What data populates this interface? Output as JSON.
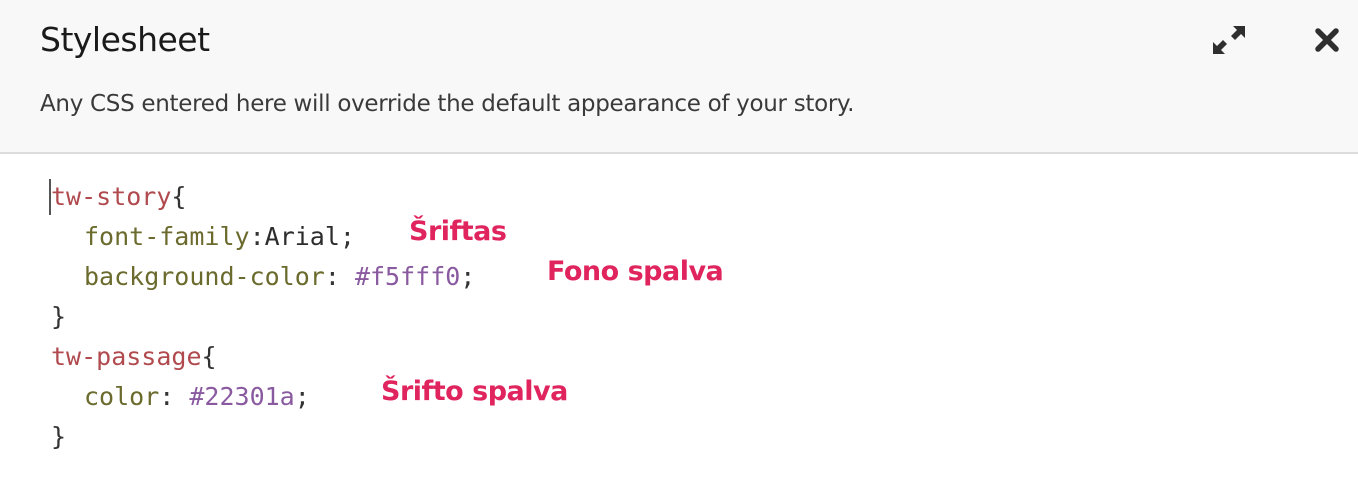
{
  "header": {
    "title": "Stylesheet",
    "subtitle": "Any CSS entered here will override the default appearance of your story."
  },
  "icons": {
    "expand": "expand-arrows-icon",
    "close": "close-x-icon"
  },
  "code": {
    "line1_selector": "tw-story",
    "line1_brace": "{",
    "line2_prop": "font-family",
    "line2_colon": ":",
    "line2_value": "Arial",
    "line2_semi": ";",
    "line3_prop": "background-color",
    "line3_colon": ": ",
    "line3_value": "#f5fff0",
    "line3_semi": ";",
    "line4_brace": "}",
    "line5_selector": "tw-passage",
    "line5_brace": "{",
    "line6_prop": "color",
    "line6_colon": ": ",
    "line6_value": "#22301a",
    "line6_semi": ";",
    "line7_brace": "}"
  },
  "annotations": {
    "font": "Šriftas",
    "background": "Fono spalva",
    "font_color": "Šrifto spalva"
  },
  "colors": {
    "selector": "#b04a4e",
    "property": "#6b6b2e",
    "number": "#8a5aa0",
    "annotation": "#e0245e"
  }
}
